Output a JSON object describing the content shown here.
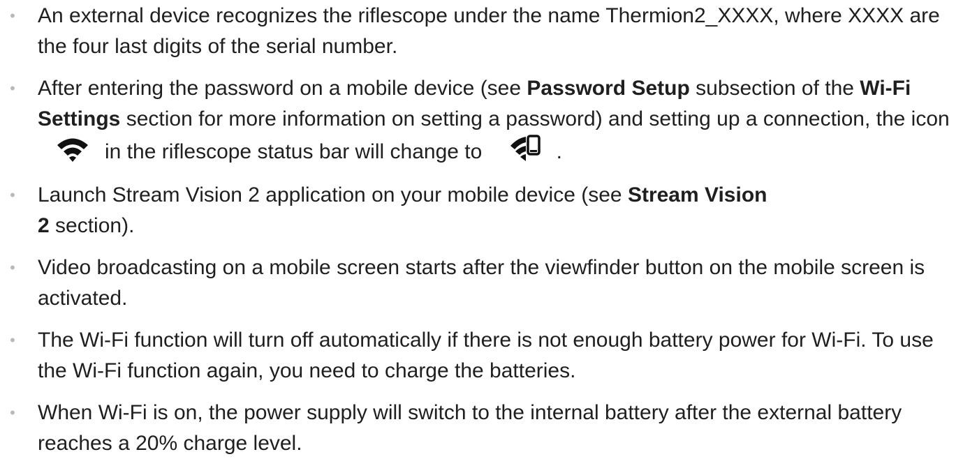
{
  "bullets": [
    {
      "text": "An external device recognizes the riflescope under the name Thermion2_XXXX, where XXXX are the four last digits of the serial number."
    },
    {
      "p1": "After entering the password on a mobile device (see ",
      "b1": "Password Setup",
      "p2": " subsection of the ",
      "b2": "Wi-Fi Settings",
      "p3": " section for more information on setting a password) and setting up a connection, the icon",
      "p4": "in the riflescope status bar will change to",
      "p5": ".",
      "icon1": "wifi-icon",
      "icon2": "wifi-connected-phone-icon"
    },
    {
      "p1": "Launch Stream Vision 2 application on your mobile device (see ",
      "b1": "Stream Vision",
      "b2": "2",
      "p2": " section)."
    },
    {
      "text": "Video broadcasting on a mobile screen starts after the viewfinder button on the mobile screen is activated."
    },
    {
      "text": "The Wi-Fi function will turn off automatically if there is not enough battery power for Wi-Fi. To use the Wi-Fi function again, you need to charge the batteries."
    },
    {
      "text": "When Wi-Fi is on, the power supply will switch to the internal battery after the external battery reaches a 20% charge level."
    }
  ],
  "bullet_glyph": "•"
}
